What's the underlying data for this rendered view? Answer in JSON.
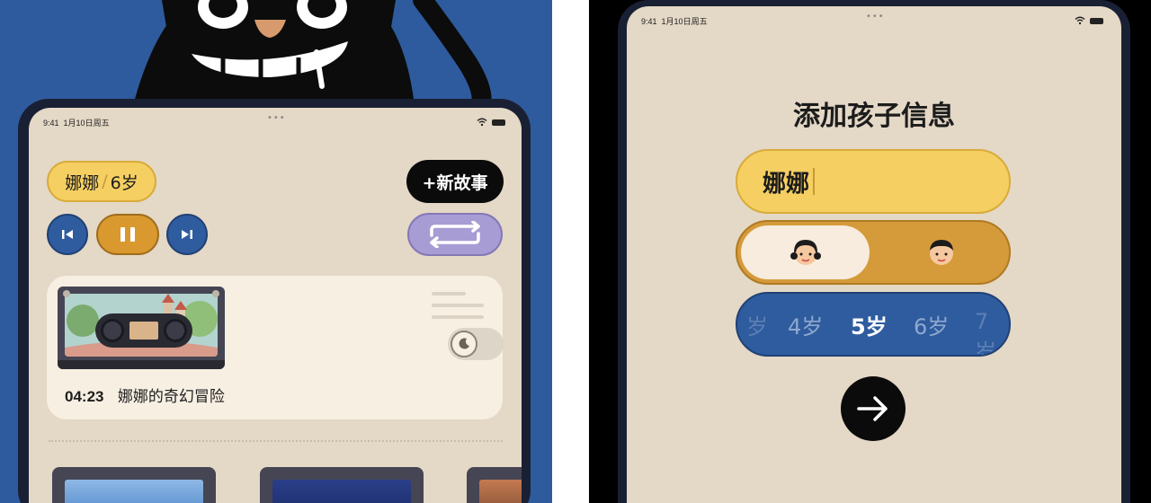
{
  "left_screen": {
    "status": {
      "time": "9:41",
      "date": "1月10日周五",
      "dots": "•••"
    },
    "profile": {
      "name": "娜娜",
      "separator": "/",
      "age": "6岁"
    },
    "new_story_label": "+新故事",
    "now_playing": {
      "time": "04:23",
      "title": "娜娜的奇幻冒险"
    }
  },
  "right_screen": {
    "status": {
      "time": "9:41",
      "date": "1月10日周五",
      "dots": "•••"
    },
    "title": "添加孩子信息",
    "name_value": "娜娜",
    "age_picker": {
      "options": [
        "岁",
        "4岁",
        "5岁",
        "6岁",
        "7岁"
      ],
      "selected": "5岁"
    }
  },
  "colors": {
    "blue": "#2e5b9d",
    "gold": "#f5cf62",
    "orange": "#d9992f",
    "lavender": "#a89cd4",
    "cream": "#e4d8c6"
  }
}
